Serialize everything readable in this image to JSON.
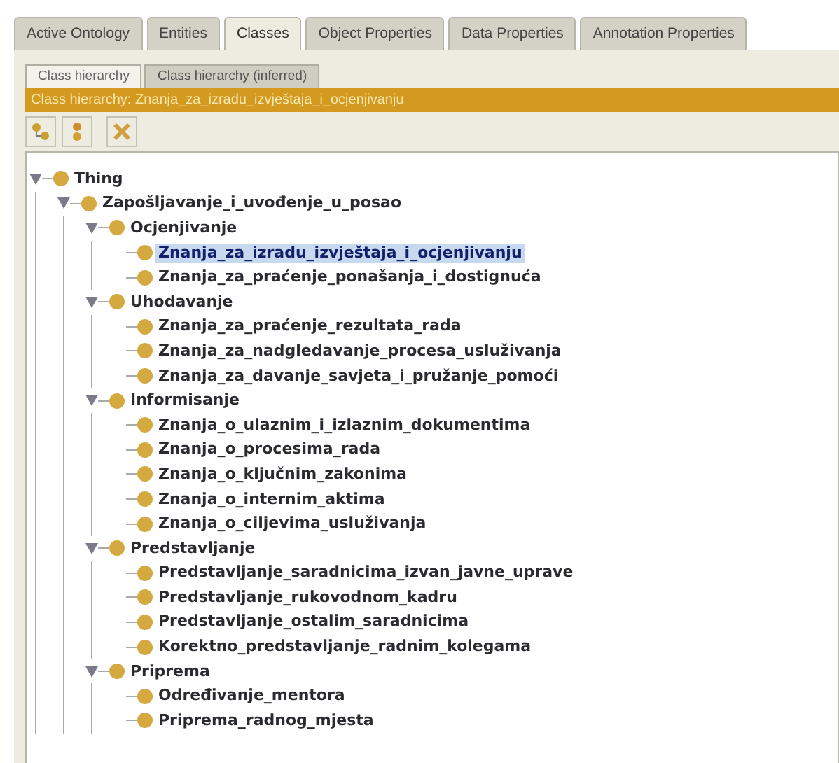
{
  "tabs": [
    {
      "label": "Active Ontology",
      "selected": false
    },
    {
      "label": "Entities",
      "selected": false
    },
    {
      "label": "Classes",
      "selected": true
    },
    {
      "label": "Object Properties",
      "selected": false
    },
    {
      "label": "Data Properties",
      "selected": false
    },
    {
      "label": "Annotation Properties",
      "selected": false
    }
  ],
  "subtabs": [
    {
      "label": "Class hierarchy",
      "selected": true
    },
    {
      "label": "Class hierarchy (inferred)",
      "selected": false
    }
  ],
  "view_title": "Class hierarchy: Znanja_za_izradu_izvještaja_i_ocjenjivanju",
  "toolbar": [
    {
      "kind": "add-subclass"
    },
    {
      "kind": "add-sibling"
    },
    {
      "kind": "delete"
    }
  ],
  "tree": [
    {
      "label": "Thing",
      "expanded": true,
      "selected": false,
      "children": [
        {
          "label": "Zapošljavanje_i_uvođenje_u_posao",
          "expanded": true,
          "selected": false,
          "children": [
            {
              "label": "Ocjenjivanje",
              "expanded": true,
              "selected": false,
              "children": [
                {
                  "label": "Znanja_za_izradu_izvještaja_i_ocjenjivanju",
                  "selected": true
                },
                {
                  "label": "Znanja_za_praćenje_ponašanja_i_dostignuća",
                  "selected": false
                }
              ]
            },
            {
              "label": "Uhodavanje",
              "expanded": true,
              "selected": false,
              "children": [
                {
                  "label": "Znanja_za_praćenje_rezultata_rada",
                  "selected": false
                },
                {
                  "label": "Znanja_za_nadgledavanje_procesa_usluživanja",
                  "selected": false
                },
                {
                  "label": "Znanja_za_davanje_savjeta_i_pružanje_pomoći",
                  "selected": false
                }
              ]
            },
            {
              "label": "Informisanje",
              "expanded": true,
              "selected": false,
              "children": [
                {
                  "label": "Znanja_o_ulaznim_i_izlaznim_dokumentima",
                  "selected": false
                },
                {
                  "label": "Znanja_o_procesima_rada",
                  "selected": false
                },
                {
                  "label": "Znanja_o_ključnim_zakonima",
                  "selected": false
                },
                {
                  "label": "Znanja_o_internim_aktima",
                  "selected": false
                },
                {
                  "label": "Znanja_o_ciljevima_usluživanja",
                  "selected": false
                }
              ]
            },
            {
              "label": "Predstavljanje",
              "expanded": true,
              "selected": false,
              "children": [
                {
                  "label": "Predstavljanje_saradnicima_izvan_javne_uprave",
                  "selected": false
                },
                {
                  "label": "Predstavljanje_rukovodnom_kadru",
                  "selected": false
                },
                {
                  "label": "Predstavljanje_ostalim_saradnicima",
                  "selected": false
                },
                {
                  "label": "Korektno_predstavljanje_radnim_kolegama",
                  "selected": false
                }
              ]
            },
            {
              "label": "Priprema",
              "expanded": true,
              "selected": false,
              "children": [
                {
                  "label": "Određivanje_mentora",
                  "selected": false
                },
                {
                  "label": "Priprema_radnog_mjesta",
                  "selected": false
                }
              ]
            }
          ]
        }
      ]
    }
  ]
}
